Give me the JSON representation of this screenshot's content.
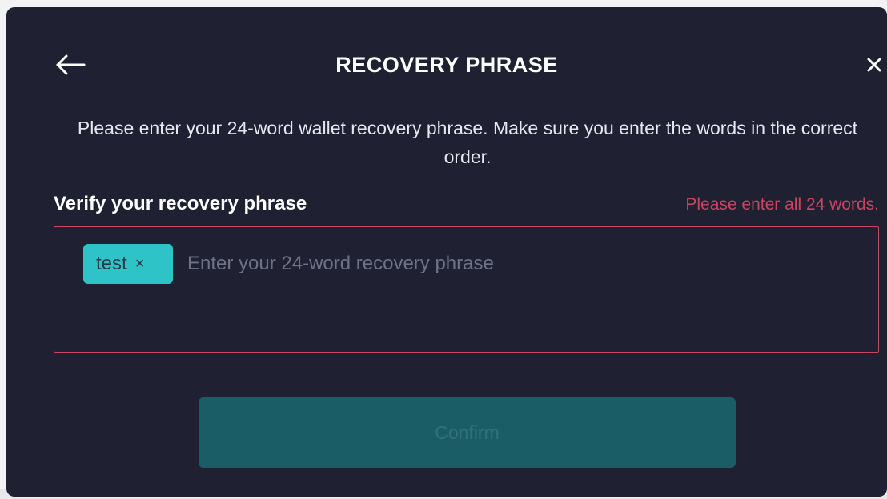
{
  "modal": {
    "title": "RECOVERY PHRASE",
    "back_icon": "arrow-left-icon",
    "close_icon": "close-icon",
    "instructions": "Please enter your 24-word wallet recovery phrase. Make sure you enter the words in the correct order.",
    "verify_label": "Verify your recovery phrase",
    "error_message": "Please enter all 24 words.",
    "phrase_input": {
      "placeholder": "Enter your 24-word recovery phrase",
      "value": "",
      "chips": [
        {
          "word": "test",
          "remove_icon": "chip-remove-icon",
          "remove_glyph": "×"
        }
      ]
    },
    "confirm_label": "Confirm",
    "close_glyph": "×"
  },
  "colors": {
    "modal_background": "#1f2032",
    "accent_teal": "#2ec4c7",
    "error_red": "#c9455f",
    "confirm_disabled": "#1b5d66"
  }
}
